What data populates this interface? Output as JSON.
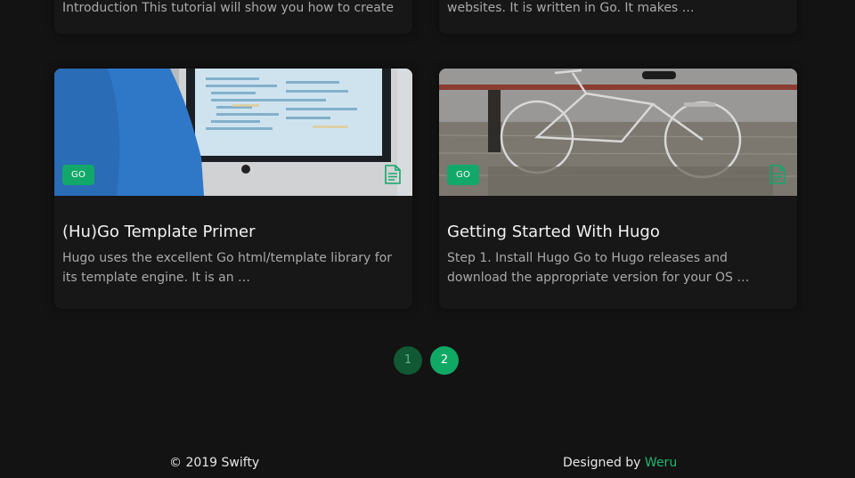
{
  "top_cards": [
    {
      "excerpt": "Introduction This tutorial will show you how to create"
    },
    {
      "excerpt": "websites. It is written in Go. It makes …"
    }
  ],
  "posts": [
    {
      "tag": "GO",
      "title": "(Hu)Go Template Primer",
      "excerpt": "Hugo uses the excellent Go html/template library for its template engine. It is an …",
      "image_icon": "imac-coding-photo",
      "post_icon": "document-icon"
    },
    {
      "tag": "GO",
      "title": "Getting Started With Hugo",
      "excerpt": "Step 1. Install Hugo Go to Hugo releases and download the appropriate version for your OS …",
      "image_icon": "bicycle-in-water-photo",
      "post_icon": "document-icon"
    }
  ],
  "pagination": {
    "pages": [
      "1",
      "2"
    ],
    "current": "2"
  },
  "footer": {
    "copyright": "© 2019 Swifty",
    "designed_by": "Designed by",
    "designer": "Weru"
  },
  "colors": {
    "accent": "#12a86a",
    "background": "#131313",
    "card": "#171717"
  }
}
